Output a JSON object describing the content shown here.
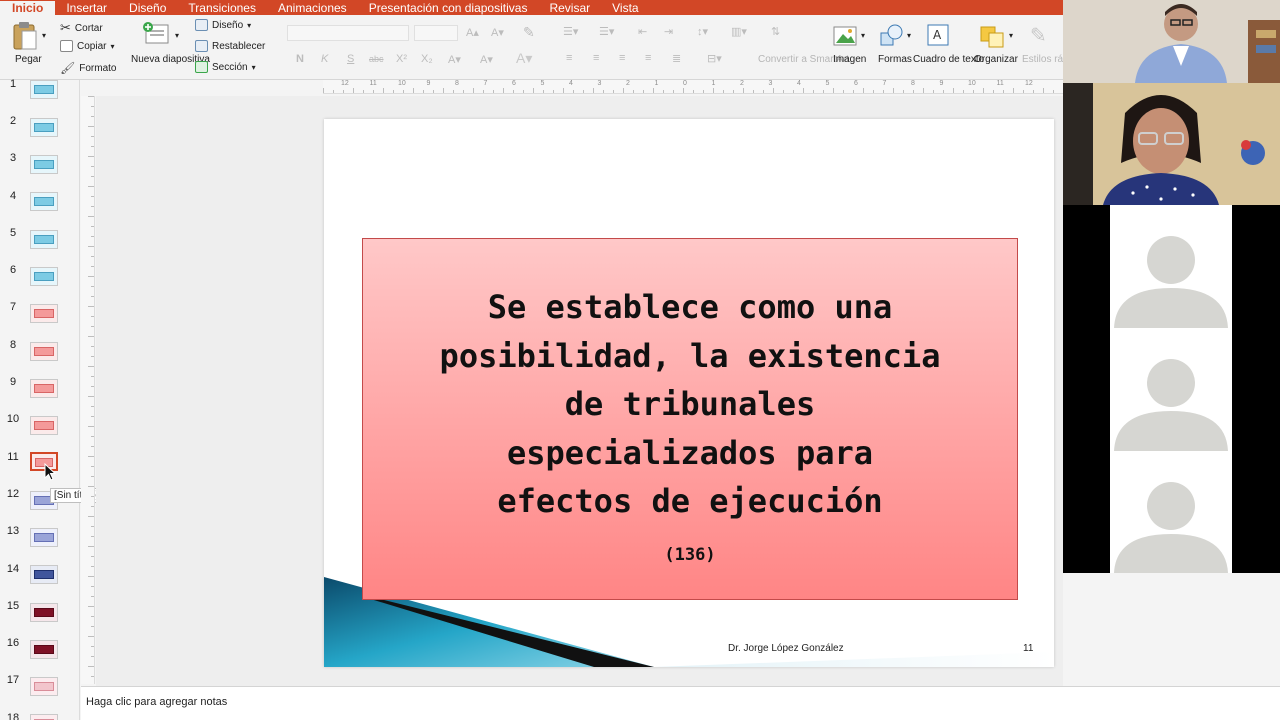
{
  "ribbon": {
    "tabs": [
      "Inicio",
      "Insertar",
      "Diseño",
      "Transiciones",
      "Animaciones",
      "Presentación con diapositivas",
      "Revisar",
      "Vista"
    ],
    "active_tab": "Inicio",
    "accent_color": "#d24726"
  },
  "toolbar": {
    "paste_label": "Pegar",
    "cut_label": "Cortar",
    "copy_label": "Copiar",
    "format_label": "Formato",
    "new_slide_label": "Nueva diapositiva",
    "layout_label": "Diseño",
    "reset_label": "Restablecer",
    "section_label": "Sección",
    "bold_label": "N",
    "italic_label": "K",
    "underline_label": "S",
    "strike_label": "abc",
    "superscript_label": "X²",
    "subscript_label": "X₂",
    "convert_smartart_label": "Convertir a SmartArt",
    "image_label": "Imagen",
    "shapes_label": "Formas",
    "textbox_label": "Cuadro de texto",
    "arrange_label": "Organizar",
    "quick_styles_label": "Estilos rápidos"
  },
  "thumbnails": {
    "numbers": [
      "1",
      "2",
      "3",
      "4",
      "5",
      "6",
      "7",
      "8",
      "9",
      "10",
      "11",
      "12",
      "13",
      "14",
      "15",
      "16",
      "17",
      "18"
    ],
    "selected": "11",
    "tooltip": "[Sin título]"
  },
  "ruler": {
    "labels": [
      "12",
      "11",
      "10",
      "9",
      "8",
      "7",
      "6",
      "5",
      "4",
      "3",
      "2",
      "1",
      "0",
      "1",
      "2",
      "3",
      "4",
      "5",
      "6",
      "7",
      "8",
      "9",
      "10",
      "11",
      "12"
    ]
  },
  "slide": {
    "title_lines": [
      "Se establece como una",
      "posibilidad, la existencia",
      "de tribunales",
      "especializados para",
      "efectos de ejecución"
    ],
    "subtitle": "(136)",
    "author": "Dr. Jorge López González",
    "number": "11"
  },
  "notes": {
    "placeholder": "Haga clic para agregar notas"
  },
  "video": {
    "participants": [
      "participant-1",
      "participant-2",
      "participant-3",
      "participant-4",
      "participant-5"
    ]
  }
}
